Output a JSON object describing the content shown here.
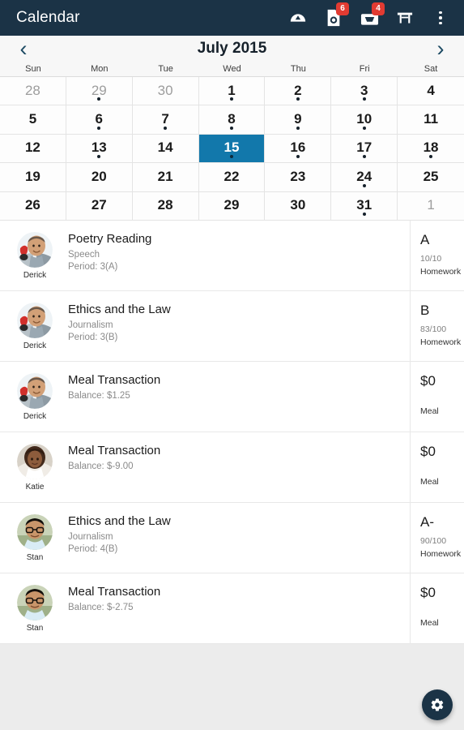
{
  "appbar": {
    "title": "Calendar",
    "actions": [
      {
        "name": "dashboard-gauge-icon",
        "badge": null
      },
      {
        "name": "assignments-icon",
        "badge": "6"
      },
      {
        "name": "inbox-icon",
        "badge": "4"
      },
      {
        "name": "table-icon",
        "badge": null
      },
      {
        "name": "overflow-menu-icon",
        "badge": null
      }
    ]
  },
  "calendar": {
    "month_title": "July 2015",
    "prev_label": "‹",
    "next_label": "›",
    "weekdays": [
      "Sun",
      "Mon",
      "Tue",
      "Wed",
      "Thu",
      "Fri",
      "Sat"
    ],
    "selected_color": "#1278ab",
    "days": [
      {
        "num": "28",
        "other": true,
        "dot": false,
        "selected": false
      },
      {
        "num": "29",
        "other": true,
        "dot": true,
        "selected": false
      },
      {
        "num": "30",
        "other": true,
        "dot": false,
        "selected": false
      },
      {
        "num": "1",
        "other": false,
        "dot": true,
        "selected": false
      },
      {
        "num": "2",
        "other": false,
        "dot": true,
        "selected": false
      },
      {
        "num": "3",
        "other": false,
        "dot": true,
        "selected": false
      },
      {
        "num": "4",
        "other": false,
        "dot": false,
        "selected": false
      },
      {
        "num": "5",
        "other": false,
        "dot": false,
        "selected": false
      },
      {
        "num": "6",
        "other": false,
        "dot": true,
        "selected": false
      },
      {
        "num": "7",
        "other": false,
        "dot": true,
        "selected": false
      },
      {
        "num": "8",
        "other": false,
        "dot": true,
        "selected": false
      },
      {
        "num": "9",
        "other": false,
        "dot": true,
        "selected": false
      },
      {
        "num": "10",
        "other": false,
        "dot": true,
        "selected": false
      },
      {
        "num": "11",
        "other": false,
        "dot": false,
        "selected": false
      },
      {
        "num": "12",
        "other": false,
        "dot": false,
        "selected": false
      },
      {
        "num": "13",
        "other": false,
        "dot": true,
        "selected": false
      },
      {
        "num": "14",
        "other": false,
        "dot": false,
        "selected": false
      },
      {
        "num": "15",
        "other": false,
        "dot": true,
        "selected": true
      },
      {
        "num": "16",
        "other": false,
        "dot": true,
        "selected": false
      },
      {
        "num": "17",
        "other": false,
        "dot": true,
        "selected": false
      },
      {
        "num": "18",
        "other": false,
        "dot": true,
        "selected": false
      },
      {
        "num": "19",
        "other": false,
        "dot": false,
        "selected": false
      },
      {
        "num": "20",
        "other": false,
        "dot": false,
        "selected": false
      },
      {
        "num": "21",
        "other": false,
        "dot": false,
        "selected": false
      },
      {
        "num": "22",
        "other": false,
        "dot": false,
        "selected": false
      },
      {
        "num": "23",
        "other": false,
        "dot": false,
        "selected": false
      },
      {
        "num": "24",
        "other": false,
        "dot": true,
        "selected": false
      },
      {
        "num": "25",
        "other": false,
        "dot": false,
        "selected": false
      },
      {
        "num": "26",
        "other": false,
        "dot": false,
        "selected": false
      },
      {
        "num": "27",
        "other": false,
        "dot": false,
        "selected": false
      },
      {
        "num": "28",
        "other": false,
        "dot": false,
        "selected": false
      },
      {
        "num": "29",
        "other": false,
        "dot": false,
        "selected": false
      },
      {
        "num": "30",
        "other": false,
        "dot": false,
        "selected": false
      },
      {
        "num": "31",
        "other": false,
        "dot": true,
        "selected": false
      },
      {
        "num": "1",
        "other": true,
        "dot": false,
        "selected": false
      }
    ]
  },
  "events": [
    {
      "person": "Derick",
      "avatar": "man-suit",
      "title": "Poetry Reading",
      "subject": "Speech",
      "detail": "Period: 3(A)",
      "grade": "A",
      "score": "10/10",
      "category": "Homework"
    },
    {
      "person": "Derick",
      "avatar": "man-suit",
      "title": "Ethics and the Law",
      "subject": "Journalism",
      "detail": "Period: 3(B)",
      "grade": "B",
      "score": "83/100",
      "category": "Homework"
    },
    {
      "person": "Derick",
      "avatar": "man-suit",
      "title": "Meal Transaction",
      "subject": "Balance: $1.25",
      "detail": "",
      "grade": "$0",
      "score": "",
      "category": "Meal"
    },
    {
      "person": "Katie",
      "avatar": "woman",
      "title": "Meal Transaction",
      "subject": "Balance: $-9.00",
      "detail": "",
      "grade": "$0",
      "score": "",
      "category": "Meal"
    },
    {
      "person": "Stan",
      "avatar": "man-glasses",
      "title": "Ethics and the Law",
      "subject": "Journalism",
      "detail": "Period: 4(B)",
      "grade": "A-",
      "score": "90/100",
      "category": "Homework"
    },
    {
      "person": "Stan",
      "avatar": "man-glasses",
      "title": "Meal Transaction",
      "subject": "Balance: $-2.75",
      "detail": "",
      "grade": "$0",
      "score": "",
      "category": "Meal"
    }
  ],
  "fab": {
    "name": "settings-gear-icon",
    "color": "#1b3346"
  }
}
